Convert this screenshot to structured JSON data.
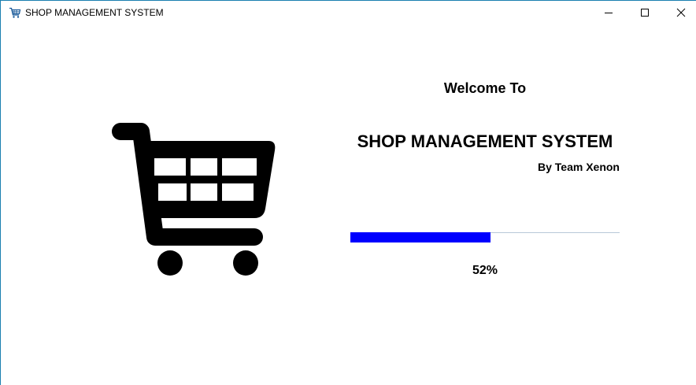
{
  "window": {
    "title": "SHOP MANAGEMENT SYSTEM",
    "icon": "shopping-cart-icon",
    "controls": {
      "minimize_icon": "minimize-icon",
      "maximize_icon": "maximize-icon",
      "close_icon": "close-icon"
    }
  },
  "splash": {
    "logo_icon": "shopping-cart-icon",
    "welcome": "Welcome To",
    "app_title": "SHOP MANAGEMENT SYSTEM",
    "byline": "By Team Xenon",
    "progress": {
      "value": 0.52,
      "label": "52%",
      "fill_color": "#0000ff"
    }
  }
}
